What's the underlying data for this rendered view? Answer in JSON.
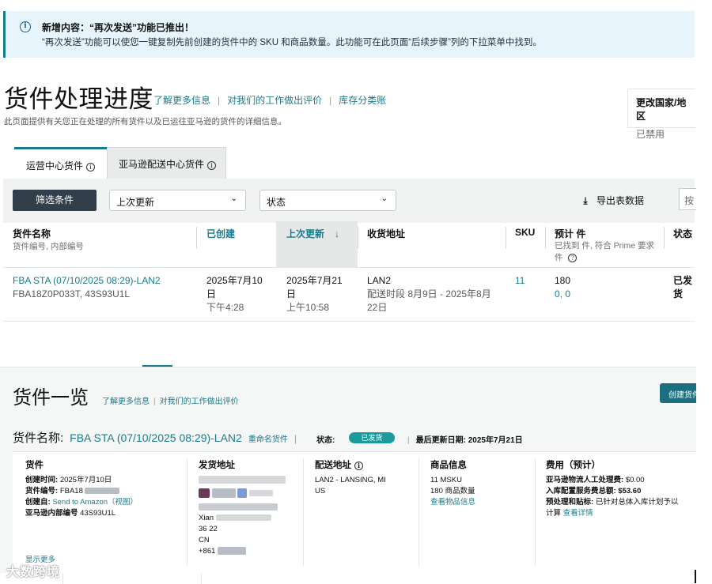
{
  "notice": {
    "title": "新增内容：“再次发送”功能已推出！",
    "body": "“再次发送”功能可以使您一键复制先前创建的货件中的 SKU 和商品数量。此功能可在此页面“后续步骤”列的下拉菜单中找到。"
  },
  "header": {
    "title": "货件处理进度",
    "links": [
      "了解更多信息",
      "对我们的工作做出评价",
      "库存分类账"
    ],
    "subtitle": "此页面提供有关您正在处理的所有货件以及已运往亚马逊的货件的详细信息。",
    "country_label": "更改国家/地区",
    "country_status": "已禁用"
  },
  "tabs": [
    {
      "label": "运营中心货件",
      "active": true
    },
    {
      "label": "亚马逊配送中心货件",
      "active": false
    }
  ],
  "toolbar": {
    "filter_label": "筛选条件",
    "sort_select": "上次更新",
    "status_select": "状态",
    "export_label": "导出表数据",
    "search_placeholder": "按"
  },
  "table": {
    "headers": {
      "name": "货件名称",
      "name_sub": "货件编号, 内部编号",
      "created": "已创建",
      "updated": "上次更新",
      "address": "收货地址",
      "sku": "SKU",
      "units": "预计 件",
      "units_sub": "已找到 件, 符合 Prime 要求",
      "units_sub2": "件",
      "status": "状态"
    },
    "row": {
      "name": "FBA STA (07/10/2025 08:29)-LAN2",
      "ids": "FBA18Z0P033T, 43S93U1L",
      "created_date": "2025年7月10",
      "created_date2": "日",
      "created_time": "下午4:28",
      "updated_date": "2025年7月21",
      "updated_date2": "日",
      "updated_time": "上午10:58",
      "address_code": "LAN2",
      "address_window": "配送时段 8月9日 - 2025年8月",
      "address_window2": "22日",
      "sku_count": "11",
      "units": "180",
      "units_found": "0, 0",
      "status": "已发",
      "status2": "货"
    }
  },
  "list": {
    "title": "货件一览",
    "links": [
      "了解更多信息",
      "对我们的工作做出评价"
    ],
    "create_label": "创建货件",
    "name_label": "货件名称:",
    "shipment_name": "FBA STA (07/10/2025 08:29)-LAN2",
    "rename": "重命名货件",
    "status_label": "状态:",
    "status_value": "已发货",
    "last_updated": "最后更新日期: 2025年7月21日"
  },
  "details": {
    "shipment": {
      "header": "货件",
      "created_label": "创建时间:",
      "created_value": "2025年7月10日",
      "number_label": "货件编号:",
      "number_value": "FBA18",
      "creator_label": "创建自:",
      "creator_value": "Send to Amazon（视图）",
      "internal_label": "亚马逊内部编号",
      "internal_value": "43S93U1L",
      "show_more": "显示更多"
    },
    "ship_from": {
      "header": "发货地址",
      "lines": [
        "Xian",
        "36 22",
        "CN",
        "+861"
      ]
    },
    "ship_to": {
      "header": "配送地址",
      "line1": "LAN2 - LANSING, MI",
      "line2": "US"
    },
    "items": {
      "header": "商品信息",
      "msku": "11 MSKU",
      "units": "180 商品数量",
      "link": "查看物品信息"
    },
    "fees": {
      "header": "费用（预计）",
      "manual_label": "亚马逊物流人工处理费:",
      "manual_value": "$0.00",
      "placement_label": "入库配置服务费总额:",
      "placement_value": "$53.60",
      "prep_label": "预处理和贴标:",
      "prep_value": "已针对总体入库计划予以",
      "prep_value2": "计算",
      "prep_link": "查看详情"
    }
  },
  "watermark": "大数跨境",
  "colors": {
    "accent": "#1b7a8a",
    "button_dark": "#323f4b",
    "status_pill": "#1a9c9c",
    "notice_bg": "#e8f4fb"
  }
}
